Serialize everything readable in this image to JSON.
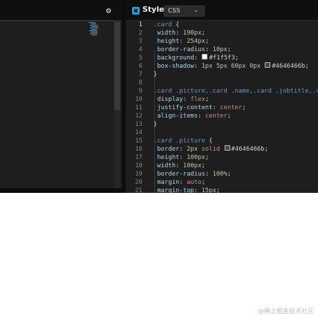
{
  "left_panel": {
    "settings_icon": "gear-icon"
  },
  "style_panel": {
    "icon": "css-icon",
    "title": "Style",
    "language": "CSS",
    "dropdown_icon": "chevron-down-icon"
  },
  "colors": {
    "accent": "#23a3d9",
    "editor_bg": "#1e1e1e",
    "selector": "#569cd6",
    "property": "#9cdcfe",
    "number": "#b5cea8",
    "string_value": "#ce9178",
    "line_number": "#858585"
  },
  "code_lines": [
    {
      "n": "1",
      "text": ".card {"
    },
    {
      "n": "2",
      "text": "width: 190px;"
    },
    {
      "n": "3",
      "text": "height: 254px;"
    },
    {
      "n": "4",
      "text": "border-radius: 10px;"
    },
    {
      "n": "5",
      "text": "background: #f1f5f3;",
      "swatch": "#f1f5f3"
    },
    {
      "n": "6",
      "text": "box-shadow: 1px 5px 60px 0px #4646466b;",
      "swatch": "#4646466b"
    },
    {
      "n": "7",
      "text": "}"
    },
    {
      "n": "8",
      "text": ""
    },
    {
      "n": "9",
      "text": ".card .picture,.card .name,.card .jobtitle,.card ."
    },
    {
      "n": "10",
      "text": "display: flex;"
    },
    {
      "n": "11",
      "text": "justify-content: center;"
    },
    {
      "n": "12",
      "text": "align-items: center;"
    },
    {
      "n": "13",
      "text": "}"
    },
    {
      "n": "14",
      "text": ""
    },
    {
      "n": "15",
      "text": ".card .picture {"
    },
    {
      "n": "16",
      "text": "border: 2px solid #4646466b;",
      "swatch": "#4646466b"
    },
    {
      "n": "17",
      "text": "height: 100px;"
    },
    {
      "n": "18",
      "text": "width: 100px;"
    },
    {
      "n": "19",
      "text": "border-radius: 100%;"
    },
    {
      "n": "20",
      "text": "margin: auto;"
    },
    {
      "n": "21",
      "text": "margin-top: 15px;"
    }
  ],
  "watermark": "@稀土掘金技术社区"
}
